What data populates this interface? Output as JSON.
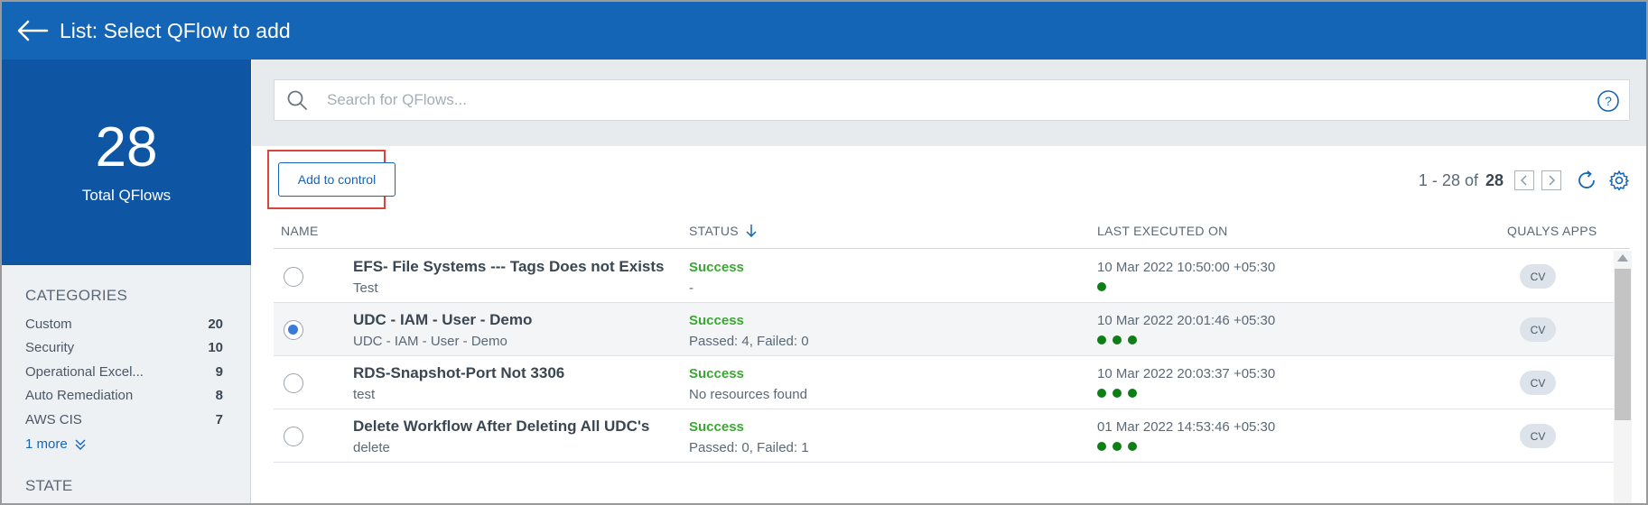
{
  "header": {
    "title": "List: Select QFlow to add"
  },
  "summary": {
    "total": "28",
    "total_label": "Total QFlows"
  },
  "categories": {
    "title": "CATEGORIES",
    "items": [
      {
        "label": "Custom",
        "count": "20"
      },
      {
        "label": "Security",
        "count": "10"
      },
      {
        "label": "Operational Excel...",
        "count": "9"
      },
      {
        "label": "Auto Remediation",
        "count": "8"
      },
      {
        "label": "AWS CIS",
        "count": "7"
      }
    ],
    "more_label": "1 more"
  },
  "state": {
    "title": "STATE"
  },
  "search": {
    "placeholder": "Search for QFlows..."
  },
  "toolbar": {
    "add_label": "Add to control"
  },
  "pagination": {
    "range": "1 - 28 of",
    "total": "28"
  },
  "table": {
    "headers": {
      "name": "NAME",
      "status": "STATUS",
      "last_executed": "LAST EXECUTED ON",
      "apps": "QUALYS APPS"
    },
    "rows": [
      {
        "name": "EFS- File Systems --- Tags Does not Exists",
        "sub": "Test",
        "status": "Success",
        "status_detail": "-",
        "date": "10 Mar 2022 10:50:00 +05:30",
        "dots": 1,
        "app": "CV",
        "selected": false
      },
      {
        "name": "UDC - IAM - User - Demo",
        "sub": "UDC - IAM - User - Demo",
        "status": "Success",
        "status_detail": "Passed: 4, Failed: 0",
        "date": "10 Mar 2022 20:01:46 +05:30",
        "dots": 3,
        "app": "CV",
        "selected": true
      },
      {
        "name": "RDS-Snapshot-Port Not 3306",
        "sub": "test",
        "status": "Success",
        "status_detail": "No resources found",
        "date": "10 Mar 2022 20:03:37 +05:30",
        "dots": 3,
        "app": "CV",
        "selected": false
      },
      {
        "name": "Delete Workflow After Deleting All UDC's",
        "sub": "delete",
        "status": "Success",
        "status_detail": "Passed: 0, Failed: 1",
        "date": "01 Mar 2022 14:53:46 +05:30",
        "dots": 3,
        "app": "CV",
        "selected": false
      }
    ]
  },
  "colors": {
    "header_bg": "#1565b6",
    "total_bg": "#0e56a4",
    "success": "#3aa832",
    "dot": "#0e7f16",
    "highlight": "#d9443f"
  },
  "icons": [
    "back-arrow-icon",
    "search-icon",
    "help-icon",
    "prev-page-icon",
    "next-page-icon",
    "refresh-icon",
    "settings-icon",
    "sort-down-icon",
    "chevron-double-down-icon"
  ]
}
